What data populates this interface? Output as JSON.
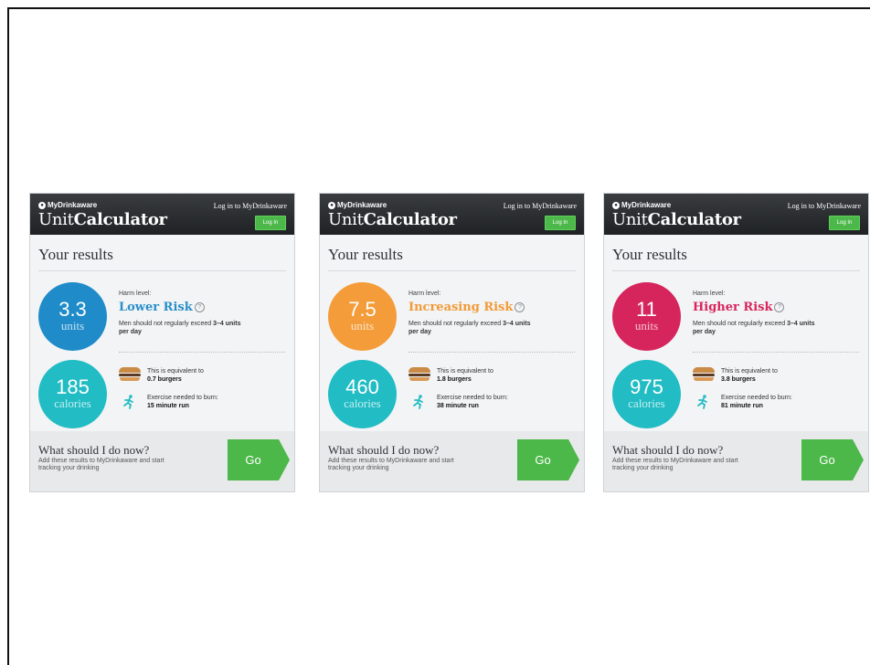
{
  "cards": [
    {
      "brand": "MyDrinkaware",
      "app_title_prefix": "Unit",
      "app_title_bold": "Calculator",
      "login_text": "Log in to MyDrinkaware",
      "login_button": "Log In",
      "results_title": "Your results",
      "units_value": "3.3",
      "units_label": "units",
      "harm_label": "Harm level:",
      "harm_level": "Lower Risk",
      "harm_color": "#2a8fc9",
      "circle_color": "#1f8cc9",
      "advice_prefix": "Men should not regularly exceed",
      "advice_bold": "3–4 units per day",
      "calories_value": "185",
      "calories_label": "calories",
      "equiv_label": "This is equivalent to",
      "equiv_value": "0.7 burgers",
      "exercise_label": "Exercise needed to burn:",
      "exercise_value": "15 minute run",
      "footer_title": "What should I do now?",
      "footer_text": "Add these results to MyDrinkaware and start tracking your drinking",
      "go_label": "Go"
    },
    {
      "brand": "MyDrinkaware",
      "app_title_prefix": "Unit",
      "app_title_bold": "Calculator",
      "login_text": "Log in to MyDrinkaware",
      "login_button": "Log In",
      "results_title": "Your results",
      "units_value": "7.5",
      "units_label": "units",
      "harm_label": "Harm level:",
      "harm_level": "Increasing Risk",
      "harm_color": "#f29a36",
      "circle_color": "#f49c3a",
      "advice_prefix": "Men should not regularly exceed",
      "advice_bold": "3–4 units per day",
      "calories_value": "460",
      "calories_label": "calories",
      "equiv_label": "This is equivalent to",
      "equiv_value": "1.8 burgers",
      "exercise_label": "Exercise needed to burn:",
      "exercise_value": "38 minute run",
      "footer_title": "What should I do now?",
      "footer_text": "Add these results to MyDrinkaware and start tracking your drinking",
      "go_label": "Go"
    },
    {
      "brand": "MyDrinkaware",
      "app_title_prefix": "Unit",
      "app_title_bold": "Calculator",
      "login_text": "Log in to MyDrinkaware",
      "login_button": "Log In",
      "results_title": "Your results",
      "units_value": "11",
      "units_label": "units",
      "harm_label": "Harm level:",
      "harm_level": "Higher Risk",
      "harm_color": "#d8265d",
      "circle_color": "#d6255c",
      "advice_prefix": "Men should not regularly exceed",
      "advice_bold": "3–4 units per day",
      "calories_value": "975",
      "calories_label": "calories",
      "equiv_label": "This is equivalent to",
      "equiv_value": "3.8 burgers",
      "exercise_label": "Exercise needed to burn:",
      "exercise_value": "81 minute run",
      "footer_title": "What should I do now?",
      "footer_text": "Add these results to MyDrinkaware and start tracking your drinking",
      "go_label": "Go"
    }
  ],
  "accent_green": "#4cb849",
  "calories_color": "#21bcc4"
}
